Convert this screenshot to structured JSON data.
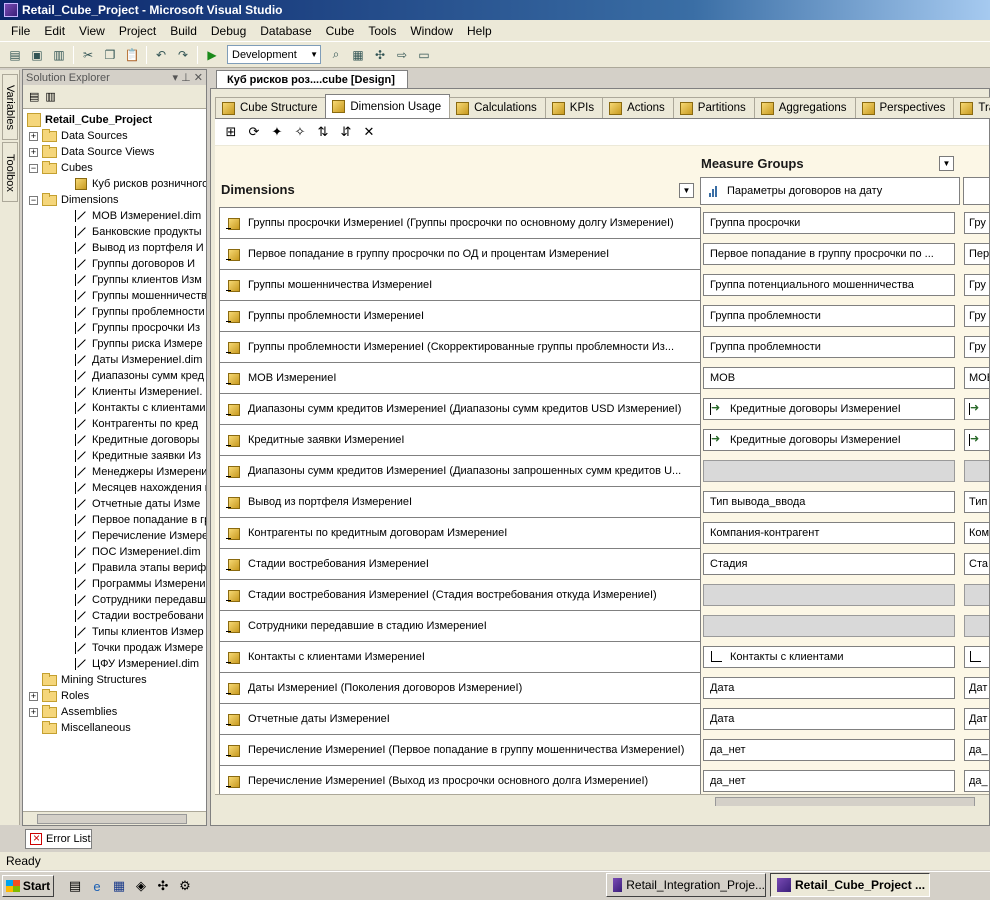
{
  "window": {
    "title": "Retail_Cube_Project - Microsoft Visual Studio"
  },
  "menu": [
    "File",
    "Edit",
    "View",
    "Project",
    "Build",
    "Debug",
    "Database",
    "Cube",
    "Tools",
    "Window",
    "Help"
  ],
  "toolbar": {
    "configuration": "Development"
  },
  "side_strip": {
    "variables_label": "Variables",
    "toolbox_label": "Toolbox"
  },
  "solution_explorer": {
    "title": "Solution Explorer",
    "project": "Retail_Cube_Project",
    "folders": {
      "data_sources": "Data Sources",
      "data_source_views": "Data Source Views",
      "cubes": "Cubes",
      "dimensions": "Dimensions",
      "mining_structures": "Mining Structures",
      "roles": "Roles",
      "assemblies": "Assemblies",
      "miscellaneous": "Miscellaneous"
    },
    "cube_item": "Куб рисков розничного",
    "dimension_items": [
      "МОВ ИзмерениеI.dim",
      "Банковские продукты",
      "Вывод из портфеля И",
      "Группы договоров И",
      "Группы клиентов Изм",
      "Группы мошенничеств",
      "Группы проблемности",
      "Группы просрочки Из",
      "Группы риска Измере",
      "Даты ИзмерениеI.dim",
      "Диапазоны сумм кред",
      "Клиенты ИзмерениеI.",
      "Контакты с клиентами",
      "Контрагенты по кред",
      "Кредитные договоры",
      "Кредитные заявки Из",
      "Менеджеры Измерени",
      "Месяцев нахождения в",
      "Отчетные даты Изме",
      "Первое попадание в гр",
      "Перечисление Измере",
      "ПОС ИзмерениеI.dim",
      "Правила этапы верифи",
      "Программы Измерени",
      "Сотрудники передавш",
      "Стадии востребовани",
      "Типы клиентов Измер",
      "Точки продаж Измере",
      "ЦФУ ИзмерениеI.dim"
    ]
  },
  "document": {
    "tab_title": "Куб рисков роз....cube [Design]",
    "designer_tabs": [
      "Cube Structure",
      "Dimension Usage",
      "Calculations",
      "KPIs",
      "Actions",
      "Partitions",
      "Aggregations",
      "Perspectives",
      "Transla"
    ],
    "active_tab": "Dimension Usage"
  },
  "grid": {
    "measure_groups_title": "Measure Groups",
    "dimensions_title": "Dimensions",
    "measure_group_col": "Параметры договоров на дату",
    "rows": [
      {
        "dimension": "Группы просрочки ИзмерениеI (Группы просрочки по основному долгу ИзмерениеI)",
        "value": "Группа просрочки",
        "value2": "Гру",
        "rel": "regular"
      },
      {
        "dimension": "Первое попадание в группу просрочки по ОД и процентам ИзмерениеI",
        "value": "Первое попадание в группу просрочки по ...",
        "value2": "Пер",
        "rel": "regular"
      },
      {
        "dimension": "Группы мошенничества ИзмерениеI",
        "value": "Группа потенциального мошенничества",
        "value2": "Гру",
        "rel": "regular"
      },
      {
        "dimension": "Группы проблемности ИзмерениеI",
        "value": "Группа проблемности",
        "value2": "Гру",
        "rel": "regular"
      },
      {
        "dimension": "Группы проблемности ИзмерениеI (Скорректированные группы проблемности Из...",
        "value": "Группа проблемности",
        "value2": "Гру",
        "rel": "regular"
      },
      {
        "dimension": "МОВ ИзмерениеI",
        "value": "МОВ",
        "value2": "МОВ",
        "rel": "regular"
      },
      {
        "dimension": "Диапазоны сумм кредитов ИзмерениеI (Диапазоны сумм кредитов USD ИзмерениеI)",
        "value": "Кредитные договоры ИзмерениеI",
        "value2": "",
        "rel": "ref"
      },
      {
        "dimension": "Кредитные заявки ИзмерениеI",
        "value": "Кредитные договоры ИзмерениеI",
        "value2": "",
        "rel": "ref"
      },
      {
        "dimension": "Диапазоны сумм кредитов ИзмерениеI (Диапазоны запрошенных сумм кредитов U...",
        "value": "",
        "value2": "",
        "rel": "empty"
      },
      {
        "dimension": "Вывод из портфеля ИзмерениеI",
        "value": "Тип вывода_ввода",
        "value2": "Тип",
        "rel": "regular"
      },
      {
        "dimension": "Контрагенты по кредитным договорам ИзмерениеI",
        "value": "Компания-контрагент",
        "value2": "Ком",
        "rel": "regular"
      },
      {
        "dimension": "Стадии востребования ИзмерениеI",
        "value": "Стадия",
        "value2": "Ста",
        "rel": "regular"
      },
      {
        "dimension": "Стадии востребования ИзмерениеI (Стадия востребования откуда ИзмерениеI)",
        "value": "",
        "value2": "",
        "rel": "empty"
      },
      {
        "dimension": "Сотрудники передавшие в стадию ИзмерениеI",
        "value": "",
        "value2": "",
        "rel": "empty"
      },
      {
        "dimension": "Контакты с клиентами ИзмерениеI",
        "value": "Контакты с клиентами",
        "value2": "",
        "rel": "fact"
      },
      {
        "dimension": "Даты ИзмерениеI (Поколения договоров ИзмерениеI)",
        "value": "Дата",
        "value2": "Дат",
        "rel": "regular"
      },
      {
        "dimension": "Отчетные даты ИзмерениеI",
        "value": "Дата",
        "value2": "Дат",
        "rel": "regular"
      },
      {
        "dimension": "Перечисление ИзмерениеI (Первое попадание в группу мошенничества ИзмерениеI)",
        "value": "да_нет",
        "value2": "да_",
        "rel": "regular"
      },
      {
        "dimension": "Перечисление ИзмерениеI (Выход из просрочки основного долга ИзмерениеI)",
        "value": "да_нет",
        "value2": "да_",
        "rel": "regular"
      }
    ]
  },
  "bottom": {
    "error_list": "Error List",
    "status": "Ready"
  },
  "taskbar": {
    "start": "Start",
    "tasks": [
      "Retail_Integration_Proje...",
      "Retail_Cube_Project ..."
    ]
  }
}
